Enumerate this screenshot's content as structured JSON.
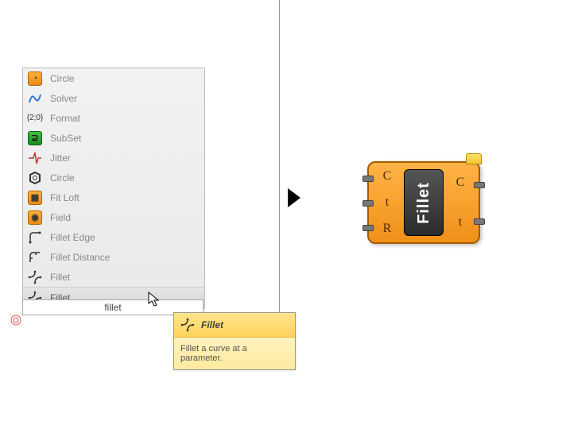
{
  "menu": {
    "items": [
      {
        "label": "Circle",
        "icon": "circle-orange"
      },
      {
        "label": "Solver",
        "icon": "solver"
      },
      {
        "label": "Format",
        "icon": "format"
      },
      {
        "label": "SubSet",
        "icon": "subset-green"
      },
      {
        "label": "Jitter",
        "icon": "jitter"
      },
      {
        "label": "Circle",
        "icon": "hex-gray"
      },
      {
        "label": "Fit Loft",
        "icon": "loft-orange"
      },
      {
        "label": "Field",
        "icon": "field-orange"
      },
      {
        "label": "Fillet Edge",
        "icon": "fillet-edge"
      },
      {
        "label": "Fillet Distance",
        "icon": "fillet-dist"
      },
      {
        "label": "Fillet",
        "icon": "fillet"
      },
      {
        "label": "Fillet",
        "icon": "fillet",
        "selected": true
      }
    ]
  },
  "search": {
    "text": "fillet"
  },
  "tooltip": {
    "title": "Fillet",
    "body": "Fillet a curve at a parameter."
  },
  "component": {
    "name": "Fillet",
    "inputs": [
      "C",
      "t",
      "R"
    ],
    "outputs": [
      "C",
      "t"
    ]
  }
}
